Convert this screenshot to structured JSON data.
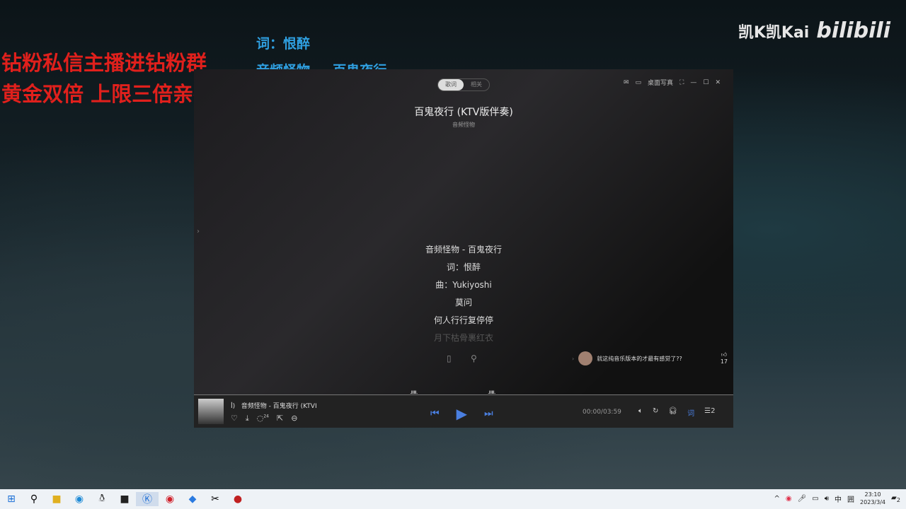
{
  "overlay": {
    "red_line1": "钻粉私信主播进钻粉群",
    "red_line2": "黄金双倍 上限三倍亲密度",
    "blue_line1": "词：恨醉",
    "blue_line2": "音频怪物 － 百鬼夜行"
  },
  "brand": {
    "streamer": "凯K凯Kai",
    "site": "bilibili"
  },
  "player": {
    "tabs": [
      "歌词",
      "相关"
    ],
    "desktop_lyrics": "桌面写真",
    "song_title": "百鬼夜行 (KTV版伴奏)",
    "artist": "音频怪物",
    "lyrics": [
      "音频怪物 - 百鬼夜行",
      "词：恨醉",
      "曲：Yukiyoshi",
      "莫问",
      "何人行行复停停",
      "月下枯骨裹红衣"
    ],
    "comment": {
      "text": "就这纯音乐版本的才最有感觉了??",
      "likes": "17"
    },
    "now_playing": "音频怪物 - 百鬼夜行 (KTVI",
    "comment_count": "24",
    "time": "00:00/03:59",
    "lyric_btn": "词",
    "queue_count": "2"
  },
  "taskbar": {
    "ime": "中",
    "time": "23:10",
    "date": "2023/3/4",
    "notifications": "2"
  }
}
